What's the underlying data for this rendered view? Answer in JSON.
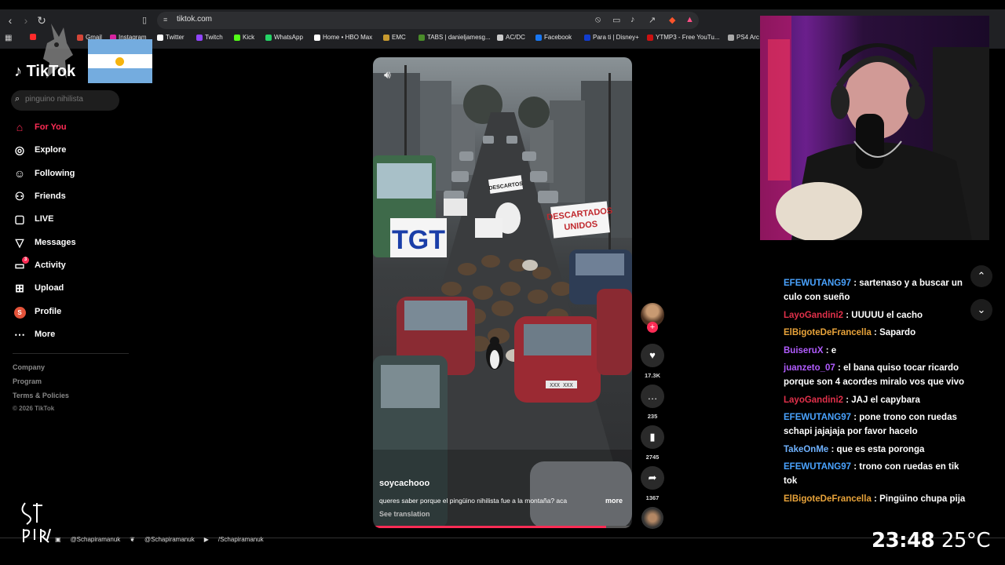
{
  "browser": {
    "url": "tiktok.com",
    "bookmarks": [
      {
        "label": "",
        "color": "#ff2b2b"
      },
      {
        "label": "Gmail",
        "color": "#d44638"
      },
      {
        "label": "Instagram",
        "color": "#d6249f"
      },
      {
        "label": "Twitter",
        "color": "#ffffff"
      },
      {
        "label": "Twitch",
        "color": "#9146ff"
      },
      {
        "label": "Kick",
        "color": "#53fc18"
      },
      {
        "label": "WhatsApp",
        "color": "#25d366"
      },
      {
        "label": "Home • HBO Max",
        "color": "#ffffff"
      },
      {
        "label": "EMC",
        "color": "#c79a2f"
      },
      {
        "label": "TABS | danieljamesg...",
        "color": "#4a8c2a"
      },
      {
        "label": "AC/DC",
        "color": "#cccccc"
      },
      {
        "label": "Facebook",
        "color": "#1877f2"
      },
      {
        "label": "Para ti | Disney+",
        "color": "#113ccf"
      },
      {
        "label": "YTMP3 - Free YouTu...",
        "color": "#c11"
      },
      {
        "label": "PS4 Arc",
        "color": "#aaaaaa"
      }
    ]
  },
  "sidebar": {
    "logo": "TikTok",
    "search_placeholder": "pinguino nihilista",
    "items": [
      {
        "label": "For You",
        "icon": "home-icon"
      },
      {
        "label": "Explore",
        "icon": "compass-icon"
      },
      {
        "label": "Following",
        "icon": "user-plus-icon"
      },
      {
        "label": "Friends",
        "icon": "users-icon"
      },
      {
        "label": "LIVE",
        "icon": "live-icon"
      },
      {
        "label": "Messages",
        "icon": "send-icon"
      },
      {
        "label": "Activity",
        "icon": "activity-icon",
        "badge": "3"
      },
      {
        "label": "Upload",
        "icon": "upload-icon"
      },
      {
        "label": "Profile",
        "icon": "profile-avatar",
        "avatar_letter": "S"
      },
      {
        "label": "More",
        "icon": "more-icon"
      }
    ],
    "footer": [
      "Company",
      "Program",
      "Terms & Policies",
      "© 2026 TikTok"
    ]
  },
  "video": {
    "author": "soycachooo",
    "caption": "queres saber porque el pingüino nihilista fue a la montaña? aca",
    "more": "more",
    "see_translation": "See translation",
    "progress_fraction": 0.9,
    "signs": [
      "TGT",
      "DESCARTADOS UNIDOS",
      "DESCARTADOS"
    ]
  },
  "actions": {
    "likes": "17.3K",
    "comments": "235",
    "saves": "2745",
    "shares": "1367"
  },
  "chat": [
    {
      "user": "EFEWUTANG97",
      "color": "#4aa3ff",
      "text": "sartenaso y a buscar un culo con sueño"
    },
    {
      "user": "LayoGandini2",
      "color": "#e0304a",
      "text": "UUUUU el cacho"
    },
    {
      "user": "ElBigoteDeFrancella",
      "color": "#e8a33a",
      "text": "Sapardo"
    },
    {
      "user": "BuiseruX",
      "color": "#b15cff",
      "text": "e"
    },
    {
      "user": "juanzeto_07",
      "color": "#b15cff",
      "text": "el bana quiso tocar ricardo porque son 4 acordes miralo vos que vivo"
    },
    {
      "user": "LayoGandini2",
      "color": "#e0304a",
      "text": "JAJ el capybara"
    },
    {
      "user": "EFEWUTANG97",
      "color": "#4aa3ff",
      "text": "pone trono con ruedas schapi jajajaja por favor hacelo"
    },
    {
      "user": "TakeOnMe",
      "color": "#6fb2ff",
      "text": "que es esta poronga"
    },
    {
      "user": "EFEWUTANG97",
      "color": "#4aa3ff",
      "text": "trono con ruedas en tik tok"
    },
    {
      "user": "ElBigoteDeFrancella",
      "color": "#e8a33a",
      "text": "Pingüino chupa pija"
    }
  ],
  "overlay": {
    "time": "23:48",
    "temperature": "25°C",
    "instagram": "@Schapiramanuk",
    "twitter": "@Schapiramanuk",
    "youtube": "/Schapiramanuk"
  }
}
